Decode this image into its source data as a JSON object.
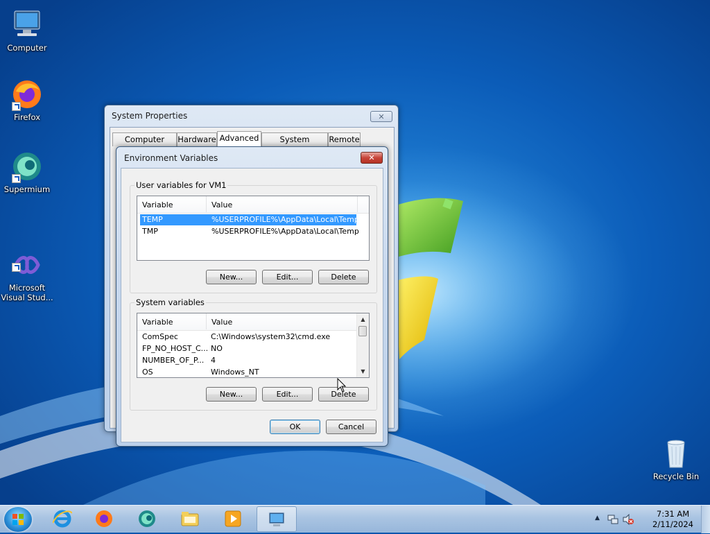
{
  "desktop": {
    "icons": [
      {
        "label": "Computer",
        "icon": "computer-icon"
      },
      {
        "label": "Firefox",
        "icon": "firefox-icon"
      },
      {
        "label": "Supermium",
        "icon": "supermium-icon"
      },
      {
        "label": "Microsoft\nVisual Stud...",
        "icon": "visual-studio-icon"
      },
      {
        "label": "Recycle Bin",
        "icon": "recycle-bin-icon"
      }
    ]
  },
  "system_properties": {
    "title": "System Properties",
    "close": "✕",
    "tabs": [
      "Computer Name",
      "Hardware",
      "Advanced",
      "System Protection",
      "Remote"
    ],
    "active_tab": "Advanced"
  },
  "env_dialog": {
    "title": "Environment Variables",
    "close": "✕",
    "user_group": {
      "label": "User variables for VM1",
      "columns": [
        "Variable",
        "Value"
      ],
      "rows": [
        {
          "variable": "TEMP",
          "value": "%USERPROFILE%\\AppData\\Local\\Temp",
          "selected": true
        },
        {
          "variable": "TMP",
          "value": "%USERPROFILE%\\AppData\\Local\\Temp",
          "selected": false
        }
      ],
      "buttons": {
        "new": "New...",
        "edit": "Edit...",
        "delete": "Delete"
      }
    },
    "system_group": {
      "label": "System variables",
      "columns": [
        "Variable",
        "Value"
      ],
      "rows": [
        {
          "variable": "ComSpec",
          "value": "C:\\Windows\\system32\\cmd.exe"
        },
        {
          "variable": "FP_NO_HOST_C...",
          "value": "NO"
        },
        {
          "variable": "NUMBER_OF_P...",
          "value": "4"
        },
        {
          "variable": "OS",
          "value": "Windows_NT"
        }
      ],
      "buttons": {
        "new": "New...",
        "edit": "Edit...",
        "delete": "Delete"
      }
    },
    "ok": "OK",
    "cancel": "Cancel"
  },
  "taskbar": {
    "pinned": [
      "internet-explorer-icon",
      "firefox-icon",
      "supermium-icon",
      "file-explorer-icon",
      "media-player-icon",
      "system-properties-icon"
    ],
    "active": "system-properties-icon",
    "clock": {
      "time": "7:31 AM",
      "date": "2/11/2024"
    }
  },
  "colors": {
    "selection": "#3399ff",
    "close_red": "#c7453a",
    "desktop_blue": "#0b5cb8"
  }
}
